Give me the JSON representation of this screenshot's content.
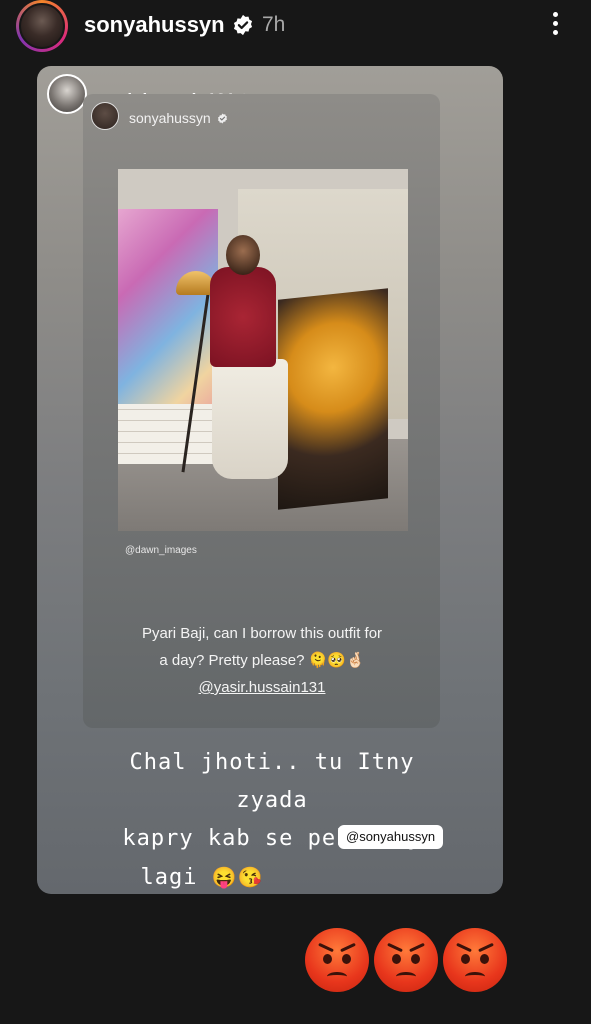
{
  "header": {
    "username": "sonyahussyn",
    "time": "7h"
  },
  "reshare": {
    "username": "yasir.hussain131"
  },
  "inner_post": {
    "username": "sonyahussyn",
    "photo_credit": "@dawn_images",
    "caption_line1": "Pyari Baji, can I borrow this outfit for",
    "caption_line2": "a day? Pretty please? 🫠🥺🤞🏻",
    "caption_mention": "@yasir.hussain131"
  },
  "reply": {
    "line1": "Chal jhoti.. tu Itny zyada",
    "line2": "kapry kab se pehennay",
    "line3": "lagi",
    "emojis": "😝😘",
    "mention": "@sonyahussyn"
  },
  "reactions": {
    "icons": [
      "angry-face-icon",
      "angry-face-icon",
      "angry-face-icon"
    ]
  },
  "colors": {
    "background": "#171717",
    "verified_badge": "#ffffff",
    "time_text": "#a8a8a8"
  }
}
